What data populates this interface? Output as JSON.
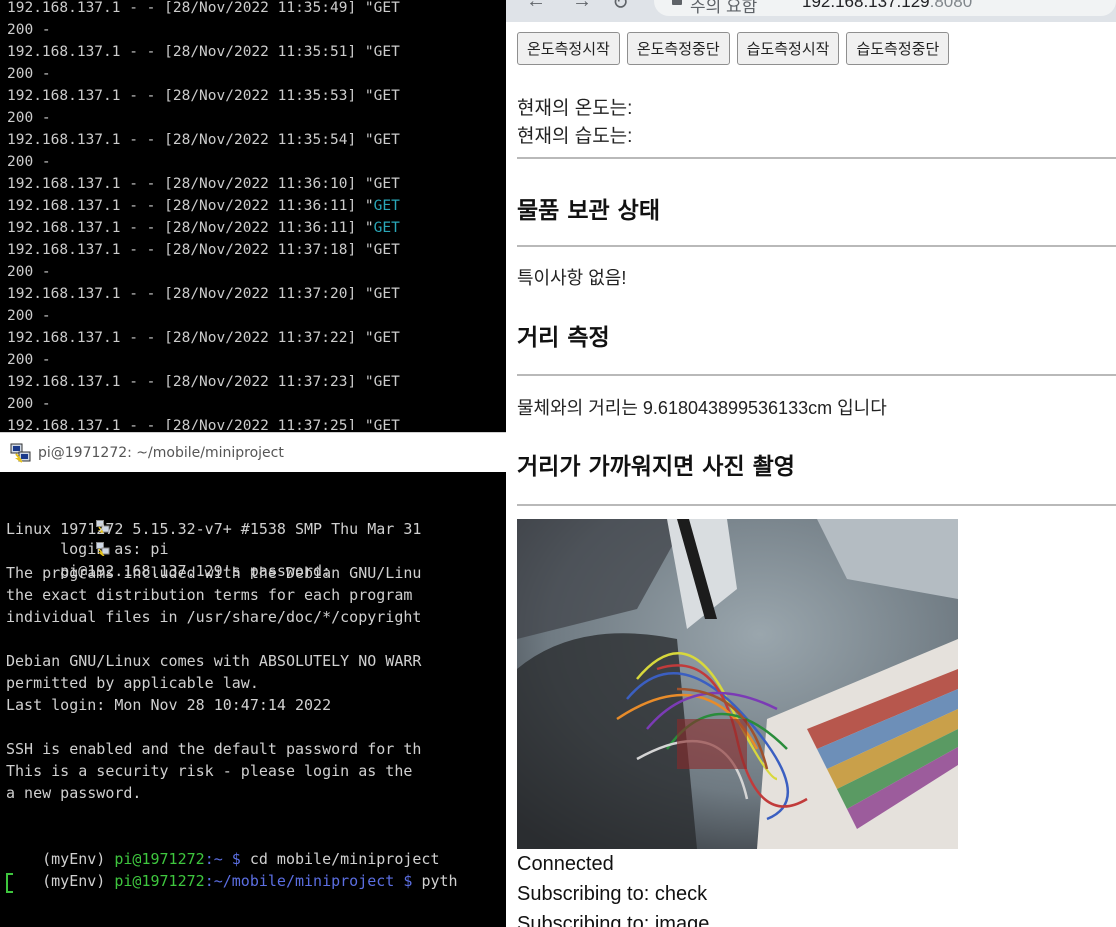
{
  "log": {
    "lines": [
      {
        "text": "192.168.137.1 - - [28/Nov/2022 11:35:49] \"GET",
        "cyan": false
      },
      {
        "text": "200 -",
        "cyan": false
      },
      {
        "text": "192.168.137.1 - - [28/Nov/2022 11:35:51] \"GET",
        "cyan": false
      },
      {
        "text": "200 -",
        "cyan": false
      },
      {
        "text": "192.168.137.1 - - [28/Nov/2022 11:35:53] \"GET",
        "cyan": false
      },
      {
        "text": "200 -",
        "cyan": false
      },
      {
        "text": "192.168.137.1 - - [28/Nov/2022 11:35:54] \"GET",
        "cyan": false
      },
      {
        "text": "200 -",
        "cyan": false
      },
      {
        "text": "192.168.137.1 - - [28/Nov/2022 11:36:10] \"GET",
        "cyan": false
      },
      {
        "text": "192.168.137.1 - - [28/Nov/2022 11:36:11] \"GET",
        "cyan": true
      },
      {
        "text": "192.168.137.1 - - [28/Nov/2022 11:36:11] \"GET",
        "cyan": true
      },
      {
        "text": "192.168.137.1 - - [28/Nov/2022 11:37:18] \"GET",
        "cyan": false
      },
      {
        "text": "200 -",
        "cyan": false
      },
      {
        "text": "192.168.137.1 - - [28/Nov/2022 11:37:20] \"GET",
        "cyan": false
      },
      {
        "text": "200 -",
        "cyan": false
      },
      {
        "text": "192.168.137.1 - - [28/Nov/2022 11:37:22] \"GET",
        "cyan": false
      },
      {
        "text": "200 -",
        "cyan": false
      },
      {
        "text": "192.168.137.1 - - [28/Nov/2022 11:37:23] \"GET",
        "cyan": false
      },
      {
        "text": "200 -",
        "cyan": false
      },
      {
        "text": "192.168.137.1 - - [28/Nov/2022 11:37:25] \"GET",
        "cyan": false
      }
    ]
  },
  "ssh": {
    "title": "pi@1971272: ~/mobile/miniproject",
    "login_prompt": "login as: pi",
    "password_prompt": "pi@192.168.137.129's password:",
    "lines": [
      "Linux 1971272 5.15.32-v7+ #1538 SMP Thu Mar 31",
      "",
      "The programs included with the Debian GNU/Linu",
      "the exact distribution terms for each program",
      "individual files in /usr/share/doc/*/copyright",
      "",
      "Debian GNU/Linux comes with ABSOLUTELY NO WARR",
      "permitted by applicable law.",
      "Last login: Mon Nov 28 10:47:14 2022",
      "",
      "SSH is enabled and the default password for th",
      "This is a security risk - please login as the",
      "a new password.",
      ""
    ],
    "prompt1": {
      "env": "(myEnv) ",
      "user": "pi@1971272",
      "path": ":~ $ ",
      "cmd": "cd mobile/miniproject"
    },
    "prompt2": {
      "env": "(myEnv) ",
      "user": "pi@1971272",
      "path": ":~/mobile/miniproject $ ",
      "cmd": "pyth"
    }
  },
  "browser": {
    "secure_label": "주의 요함",
    "url_host": "192.168.137.129",
    "url_port": ":8080",
    "buttons": [
      "온도측정시작",
      "온도측정중단",
      "습도측정시작",
      "습도측정중단"
    ],
    "temperature_label": "현재의 온도는:",
    "humidity_label": "현재의 습도는:",
    "storage_heading": "물품 보관 상태",
    "storage_status": "특이사항 없음!",
    "distance_heading": "거리 측정",
    "distance_text": "물체와의 거리는 9.618043899536133cm 입니다",
    "photo_heading": "거리가 가까워지면 사진 촬영",
    "status_lines": [
      "Connected",
      "Subscribing to: check",
      "Subscribing to: image"
    ]
  },
  "colors": {
    "terminal_green": "#3ec63e",
    "terminal_blue": "#5b6ee1",
    "terminal_cyan": "#2aa7b8"
  }
}
